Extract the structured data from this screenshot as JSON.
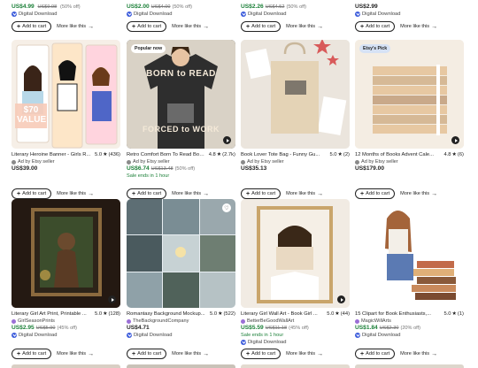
{
  "top_row": [
    {
      "seller": "",
      "price": "US$4.99",
      "original": "US$9.98",
      "discount": "(50% off)",
      "digital": "Digital Download",
      "add": "Add to cart",
      "more": "More like this"
    },
    {
      "price": "US$2.00",
      "original": "US$4.00",
      "discount": "(50% off)",
      "digital": "Digital Download",
      "add": "Add to cart",
      "more": "More like this"
    },
    {
      "price": "US$2.26",
      "original": "US$4.52",
      "discount": "(50% off)",
      "digital": "Digital Download",
      "add": "Add to cart",
      "more": "More like this"
    },
    {
      "price": "US$2.99",
      "digital": "Digital Download",
      "add": "Add to cart",
      "more": "More like this"
    }
  ],
  "middle_row": [
    {
      "badge": "",
      "overlay": "$70 VALUE",
      "title": "Literary Heroine Banner - Girls R...",
      "rating": "5.0",
      "reviews": "(436)",
      "seller": "Ad by Etsy seller",
      "price": "US$39.00",
      "add": "Add to cart",
      "more": "More like this"
    },
    {
      "badge": "Popular now",
      "shirt_line1": "BORN to READ",
      "shirt_line2": "FORCED to WORK",
      "title": "Retro Comfort Born To Read Boo...",
      "rating": "4.8",
      "reviews": "(2.7k)",
      "seller": "Ad by Etsy seller",
      "price": "US$6.74",
      "original": "US$13.48",
      "discount": "(50% off)",
      "sales": "Sale ends in 1 hour",
      "add": "Add to cart",
      "more": "More like this"
    },
    {
      "title": "Book Lover Tote Bag - Funny Gu...",
      "rating": "5.0",
      "reviews": "(2)",
      "seller": "Ad by Etsy seller",
      "price": "US$35.13",
      "add": "Add to cart",
      "more": "More like this"
    },
    {
      "badge": "Etsy's Pick",
      "title": "12 Months of Books Advent Cale...",
      "rating": "4.8",
      "reviews": "(6)",
      "seller": "Ad by Etsy seller",
      "price": "US$179.00",
      "add": "Add to cart",
      "more": "More like this"
    }
  ],
  "bottom_row": [
    {
      "title": "Literary Girl Art Print, Printable ...",
      "rating": "5.0",
      "reviews": "(128)",
      "seller": "GirlSeasonPrints",
      "price": "US$2.95",
      "original": "US$5.90",
      "discount": "(45% off)",
      "digital": "Digital Download",
      "add": "Add to cart",
      "more": "More like this"
    },
    {
      "title": "Romantasy Background Mockup...",
      "rating": "5.0",
      "reviews": "(522)",
      "seller": "TheBackgroundCompany",
      "price": "US$4.71",
      "digital": "Digital Download",
      "add": "Add to cart",
      "more": "More like this"
    },
    {
      "title": "Literary Girl Wall Art - Book Girl ...",
      "rating": "5.0",
      "reviews": "(44)",
      "seller": "BetterBeGoodWallArt",
      "price": "US$5.59",
      "original": "US$11.18",
      "discount": "(45% off)",
      "sales": "Sale ends in 1 hour",
      "digital": "Digital Download",
      "add": "Add to cart",
      "more": "More like this"
    },
    {
      "title": "15 Clipart for Book Enthusiasts,...",
      "rating": "5.0",
      "reviews": "(1)",
      "seller": "MagicWillArts",
      "price": "US$1.84",
      "original": "US$2.30",
      "discount": "(20% off)",
      "digital": "Digital Download",
      "add": "Add to cart",
      "more": "More like this"
    }
  ],
  "icons": {
    "plus": "+",
    "arrow": "→",
    "star": "★",
    "heart": "♡"
  }
}
